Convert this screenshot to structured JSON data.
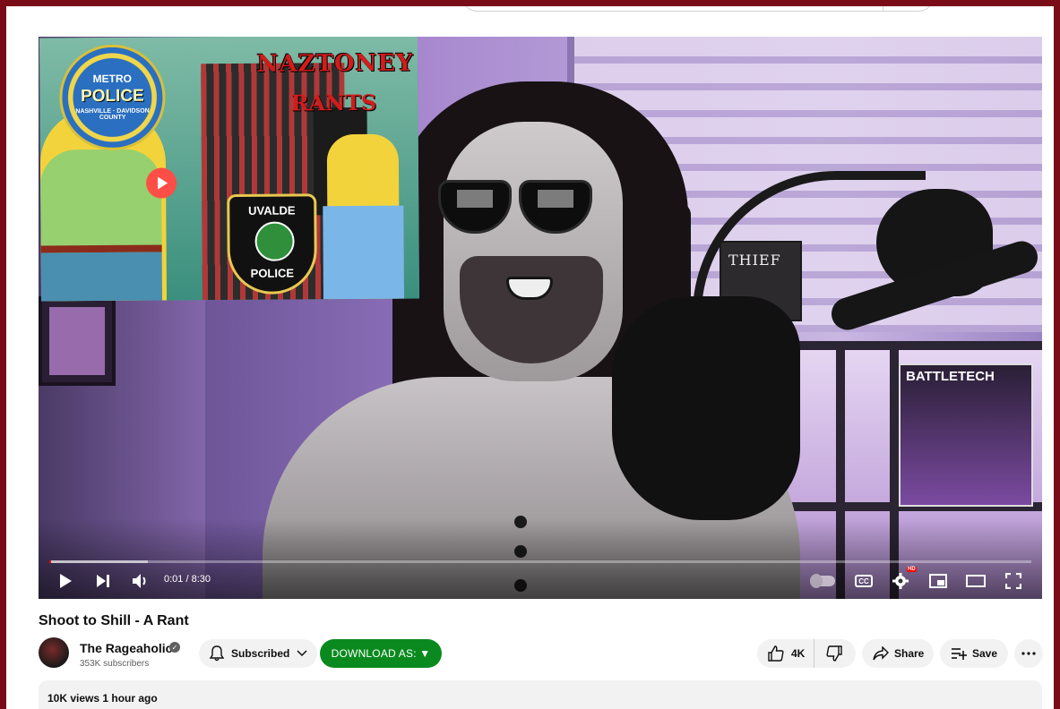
{
  "video": {
    "overlay_title_line1": "NAZTONEY",
    "overlay_title_line2": "RANTS",
    "badge_metro": {
      "line1": "METRO",
      "line2": "POLICE",
      "line3": "NASHVILLE · DAVIDSON COUNTY"
    },
    "badge_uvalde": {
      "line1": "UVALDE",
      "line2": "POLICE"
    },
    "shelf_box_label": "BATTLETECH",
    "poster_label": "THIEF",
    "progress_fraction_played": 0.002,
    "progress_fraction_buffered": 0.1
  },
  "controls": {
    "time_display": "0:01 / 8:30",
    "cc_label": "CC",
    "hd_badge": "HD"
  },
  "meta": {
    "title": "Shoot to Shill - A Rant",
    "channel_name": "The Rageaholic",
    "subscribers": "353K subscribers",
    "views_time": "10K views  1 hour ago"
  },
  "actions": {
    "subscribed_label": "Subscribed",
    "download_label": "DOWNLOAD AS: ▼",
    "like_count": "4K",
    "share_label": "Share",
    "save_label": "Save"
  },
  "colors": {
    "frame_border": "#7a0c18",
    "download_button": "#0a8a1e",
    "progress_played": "#ff0000"
  },
  "icons": [
    "play-icon",
    "next-icon",
    "volume-icon",
    "autoplay-toggle-icon",
    "captions-icon",
    "settings-icon",
    "miniplayer-icon",
    "theater-icon",
    "fullscreen-icon",
    "bell-icon",
    "chevron-down-icon",
    "like-icon",
    "dislike-icon",
    "share-icon",
    "save-playlist-icon",
    "more-icon",
    "verified-icon"
  ]
}
